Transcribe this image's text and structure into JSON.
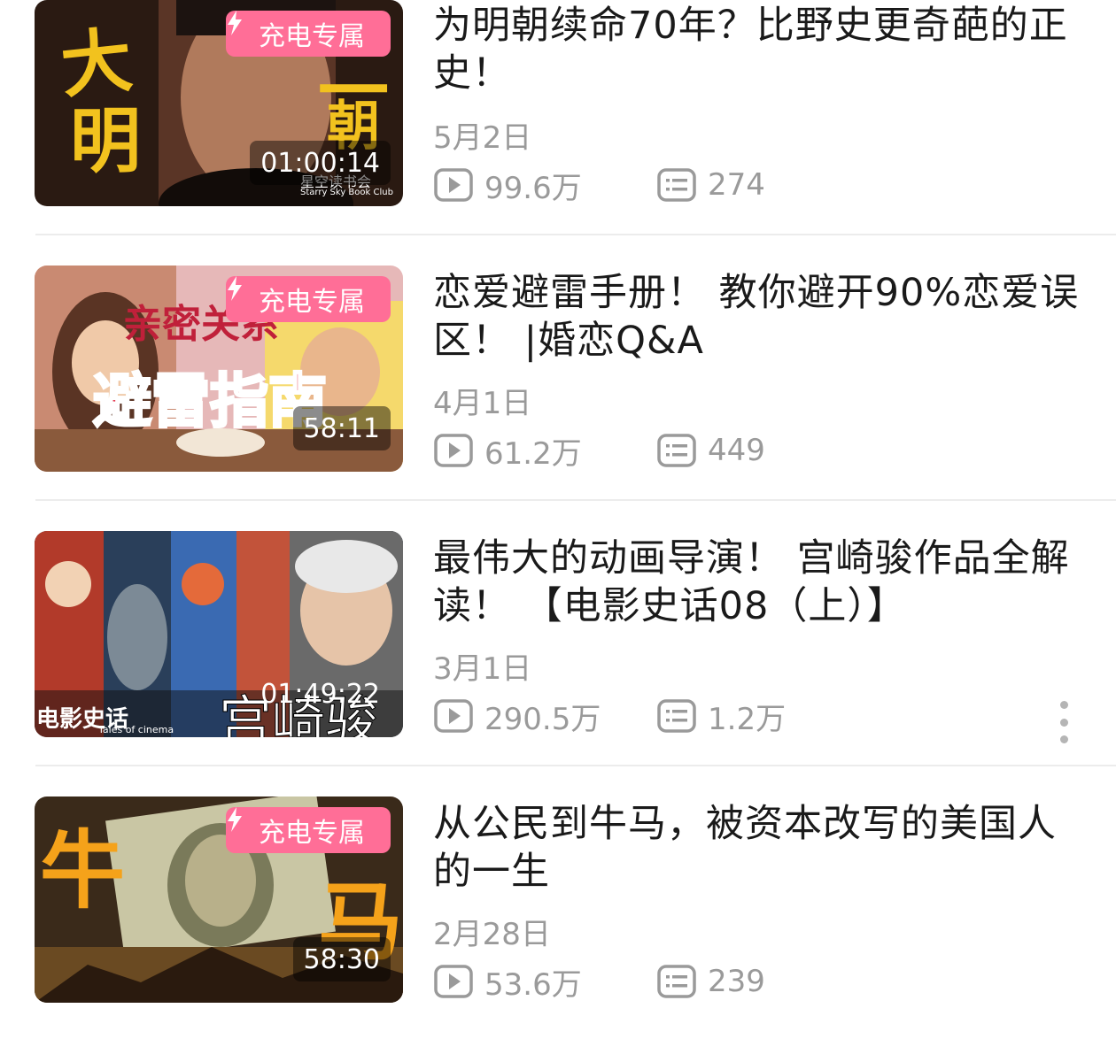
{
  "badge_label": "充电专属",
  "videos": [
    {
      "title": "为明朝续命70年？比野史更奇葩的正史！",
      "date": "5月2日",
      "views": "99.6万",
      "comments": "274",
      "duration": "01:00:14",
      "exclusive": true,
      "thumb_text": [
        "大",
        "明",
        "一",
        "朝",
        "星空读书会",
        "Starry Sky Book Club"
      ]
    },
    {
      "title": "恋爱避雷手册！ 教你避开90%恋爱误区！ |婚恋Q&A",
      "date": "4月1日",
      "views": "61.2万",
      "comments": "449",
      "duration": "58:11",
      "exclusive": true,
      "thumb_text": [
        "亲密关系",
        "避雷指南"
      ]
    },
    {
      "title": "最伟大的动画导演！ 宫崎骏作品全解读！ 【电影史话08（上）】",
      "date": "3月1日",
      "views": "290.5万",
      "comments": "1.2万",
      "duration": "01:49:22",
      "exclusive": false,
      "thumb_text": [
        "电影史话",
        "Tales of cinema",
        "宫崎骏"
      ]
    },
    {
      "title": "从公民到牛马，被资本改写的美国人的一生",
      "date": "2月28日",
      "views": "53.6万",
      "comments": "239",
      "duration": "58:30",
      "exclusive": true,
      "thumb_text": [
        "牛",
        "马"
      ]
    }
  ],
  "icons": {
    "play": "play-count-icon",
    "comment": "danmaku-count-icon",
    "bolt": "bolt-icon",
    "more": "more-vertical-icon"
  },
  "colors": {
    "badge": "#ff6e97",
    "meta_text": "#9a9a9a",
    "title_text": "#1a1a1a"
  }
}
